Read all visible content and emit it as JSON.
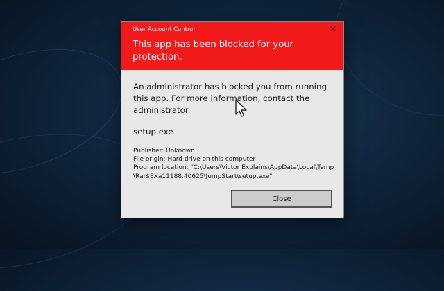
{
  "dialog": {
    "window_title": "User Account Control",
    "close_glyph": "✕",
    "headline": "This app has been blocked for your protection.",
    "message": "An administrator has blocked you from running this app. For more information, contact the administrator.",
    "app_name": "setup.exe",
    "publisher": "Publisher: Unknown",
    "file_origin": "File origin: Hard drive on this computer",
    "program_location_line1": "Program location: \"C:\\Users\\Victor Explains\\AppData\\Local\\Temp",
    "program_location_line2": "\\Rar$EXa11188.40625\\JumpStart\\setup.exe\"",
    "close_button": "Close",
    "header_color": "#f21a1a",
    "body_color": "#e8e8e8"
  },
  "icons": {
    "close": "close-icon",
    "cursor": "mouse-pointer-icon"
  }
}
